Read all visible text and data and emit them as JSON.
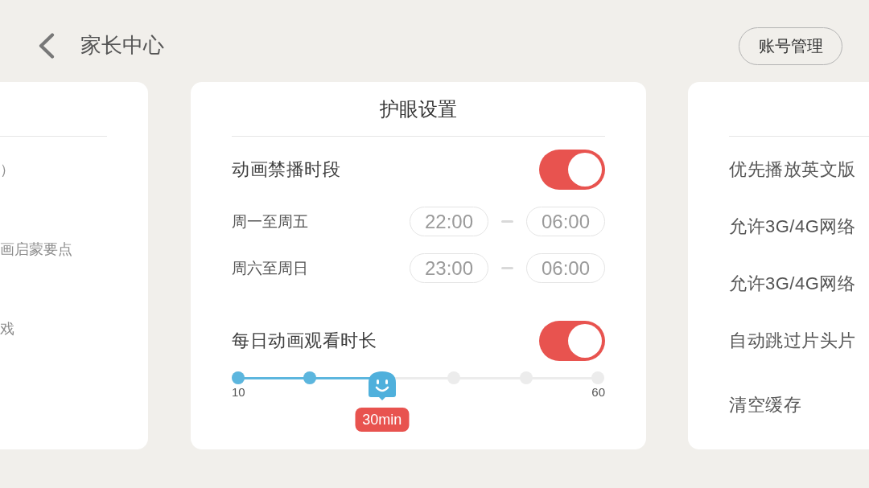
{
  "header": {
    "title": "家长中心",
    "account_button": "账号管理"
  },
  "left_panel": {
    "items": [
      "）",
      "画启蒙要点",
      "戏"
    ]
  },
  "eye_care": {
    "title": "护眼设置",
    "curfew": {
      "label": "动画禁播时段",
      "on": true,
      "periods": [
        {
          "days": "周一至周五",
          "start": "22:00",
          "end": "06:00"
        },
        {
          "days": "周六至周日",
          "start": "23:00",
          "end": "06:00"
        }
      ]
    },
    "daily_limit": {
      "label": "每日动画观看时长",
      "on": true,
      "slider": {
        "min_label": "10",
        "max_label": "60",
        "level": 0.4,
        "reading": "30min"
      }
    }
  },
  "right_panel": {
    "items": [
      "优先播放英文版",
      "允许3G/4G网络",
      "允许3G/4G网络",
      "自动跳过片头片",
      "清空缓存"
    ]
  }
}
